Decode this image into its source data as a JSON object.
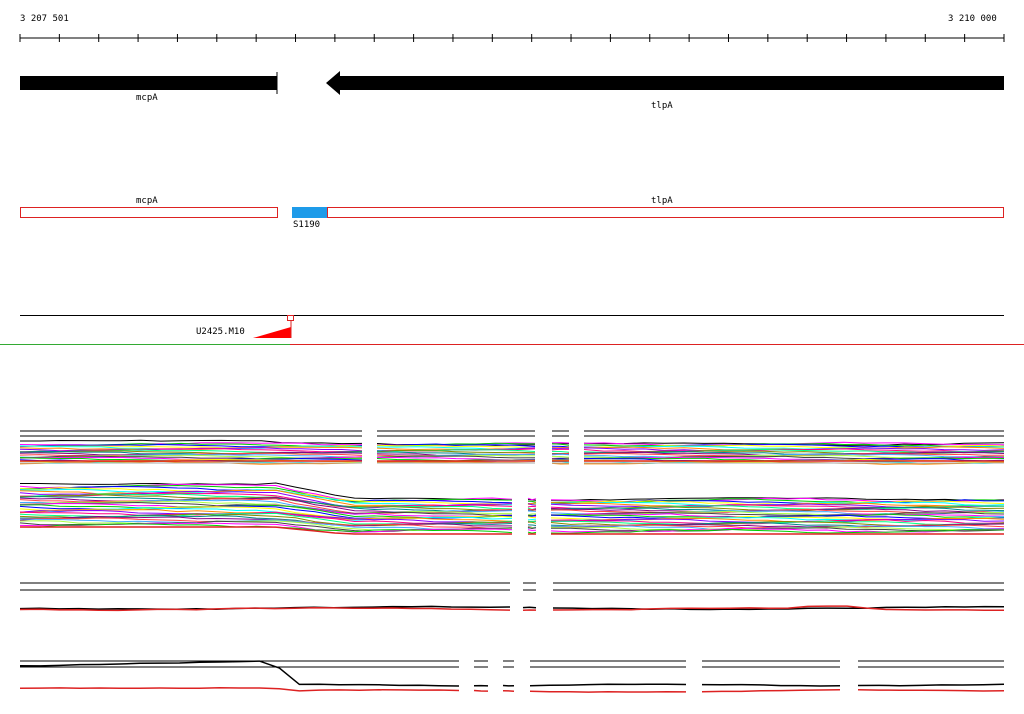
{
  "ruler": {
    "start_label": "3 207 501",
    "end_label": "3 210 000",
    "tick_count": 26
  },
  "genes": [
    {
      "name": "mcpA",
      "strand": "-",
      "label": "mcpA"
    },
    {
      "name": "tlpA",
      "strand": "-",
      "label": "tlpA"
    }
  ],
  "features": [
    {
      "name": "mcpA",
      "type": "cds-outline",
      "label": "mcpA"
    },
    {
      "name": "S1190",
      "type": "segment",
      "label": "S1190",
      "color": "#1e9be9"
    },
    {
      "name": "tlpA",
      "type": "cds-outline",
      "label": "tlpA"
    }
  ],
  "tss": {
    "label": "U2425.M10",
    "color": "#ff0000"
  },
  "colors": {
    "feature_outline": "#dd2222",
    "segment_fill": "#1e9be9",
    "tss_marker": "#ff0000",
    "separator_green": "#33aa33",
    "separator_red": "#dd2222",
    "expression_palette": [
      "#ff00ff",
      "#00cc00",
      "#0000ff",
      "#ffff00",
      "#00ffff",
      "#ff8800",
      "#8800ff",
      "#ff0088",
      "#00ff88",
      "#888800",
      "#008888",
      "#880088",
      "#ff4444",
      "#44aaff",
      "#aaff44",
      "#444444"
    ]
  },
  "tracks": [
    {
      "name": "expression-track-1",
      "type": "multi-condition"
    },
    {
      "name": "expression-track-2",
      "type": "multi-condition"
    },
    {
      "name": "expression-track-3",
      "type": "two-condition"
    },
    {
      "name": "expression-track-4",
      "type": "two-condition"
    }
  ]
}
